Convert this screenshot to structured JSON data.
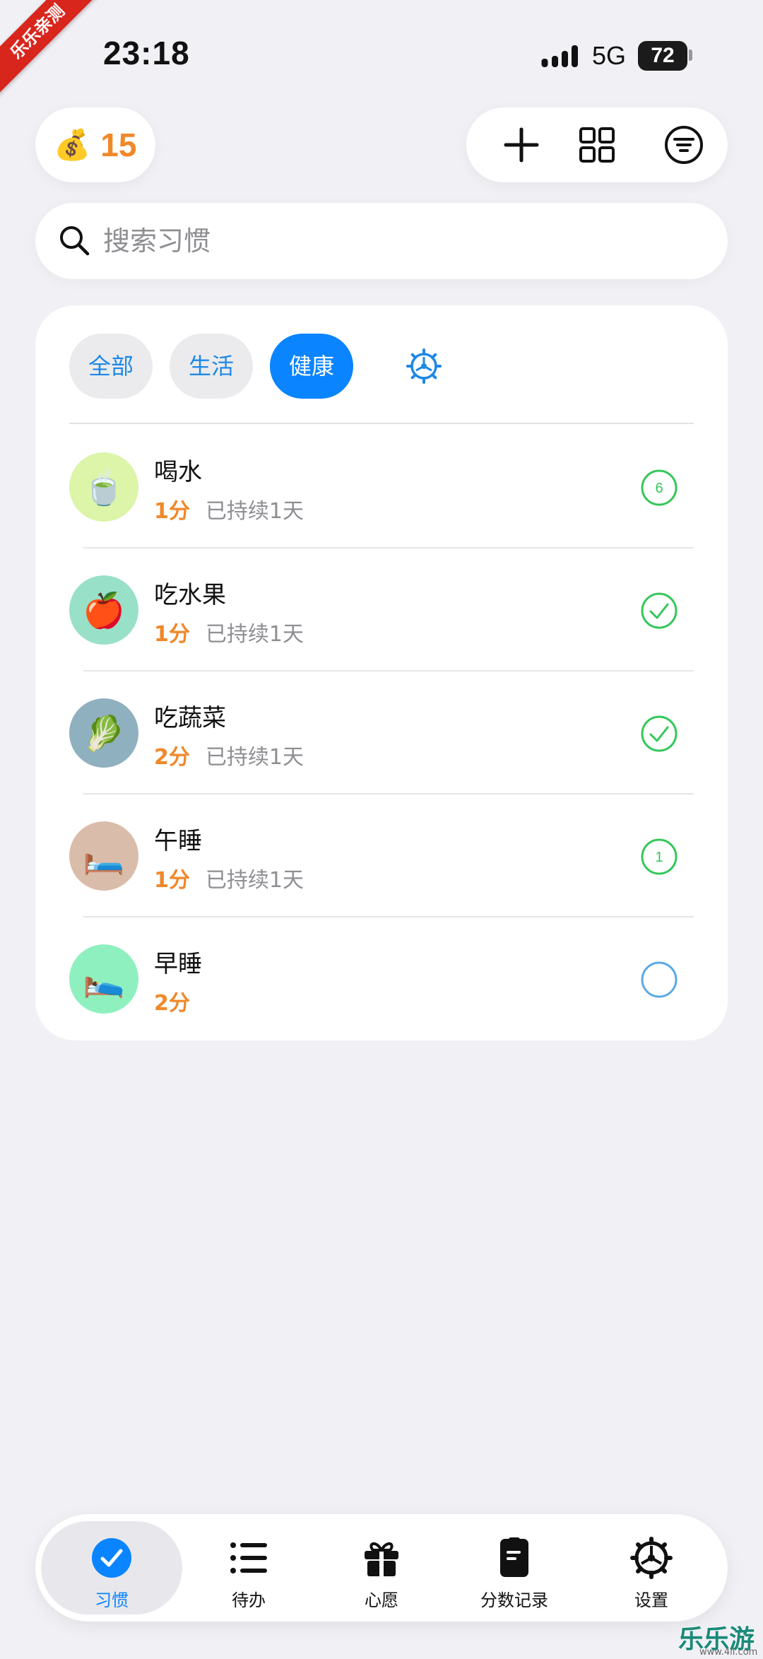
{
  "ribbon": "乐乐亲测",
  "status_bar": {
    "time": "23:18",
    "network": "5G",
    "battery": "72"
  },
  "wallet": {
    "icon": "money-bag-icon",
    "coins": "15"
  },
  "header_actions": [
    "add-icon",
    "grid-icon",
    "filter-icon"
  ],
  "search": {
    "placeholder": "搜索习惯",
    "value": ""
  },
  "categories": {
    "chips": [
      {
        "label": "全部",
        "active": false
      },
      {
        "label": "生活",
        "active": false
      },
      {
        "label": "健康",
        "active": true
      }
    ],
    "settings_icon": "gear-icon"
  },
  "habits": [
    {
      "name": "喝水",
      "points": "1分",
      "streak": "已持续1天",
      "icon": "tea-cup-icon",
      "emoji": "🍵",
      "avatar_color": "#dcf5a8",
      "status": "count",
      "count": "6"
    },
    {
      "name": "吃水果",
      "points": "1分",
      "streak": "已持续1天",
      "icon": "apple-icon",
      "emoji": "🍎",
      "avatar_color": "#99e0c8",
      "status": "done",
      "count": ""
    },
    {
      "name": "吃蔬菜",
      "points": "2分",
      "streak": "已持续1天",
      "icon": "lettuce-icon",
      "emoji": "🥬",
      "avatar_color": "#8fb0bf",
      "status": "done",
      "count": ""
    },
    {
      "name": "午睡",
      "points": "1分",
      "streak": "已持续1天",
      "icon": "bed-icon",
      "emoji": "🛏️",
      "avatar_color": "#d9bcaa",
      "status": "count",
      "count": "1"
    },
    {
      "name": "早睡",
      "points": "2分",
      "streak": "",
      "icon": "bed-icon",
      "emoji": "🛌",
      "avatar_color": "#8ff0bf",
      "status": "pending",
      "count": ""
    }
  ],
  "tabbar": [
    {
      "label": "习惯",
      "icon": "checkmark-circle-icon",
      "active": true
    },
    {
      "label": "待办",
      "icon": "list-icon",
      "active": false
    },
    {
      "label": "心愿",
      "icon": "gift-icon",
      "active": false
    },
    {
      "label": "分数记录",
      "icon": "note-icon",
      "active": false
    },
    {
      "label": "设置",
      "icon": "gear-icon",
      "active": false
    }
  ],
  "colors": {
    "accent": "#0a84ff",
    "points": "#f0882a",
    "check": "#34c759",
    "pending": "#5aa9e6"
  },
  "watermark": {
    "text": "乐乐游戏",
    "url": "www.4ll.com"
  }
}
